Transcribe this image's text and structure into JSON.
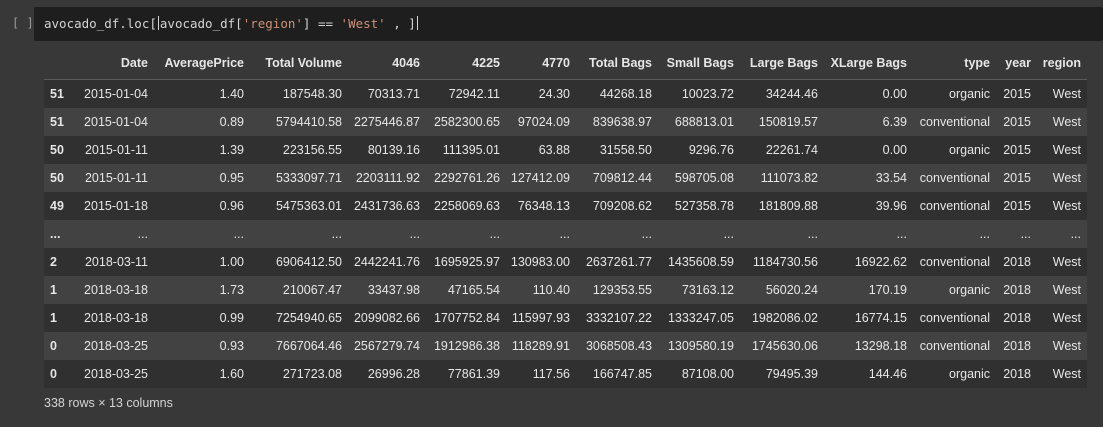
{
  "cell": {
    "run_indicator": "[ ]",
    "code": {
      "part1": "avocado_df.loc[",
      "part2": "avocado_df[",
      "string1": "'region'",
      "part3": "] == ",
      "string2": "'West'",
      "part4": " , ",
      "part5": "]"
    }
  },
  "table": {
    "columns": [
      "",
      "Date",
      "AveragePrice",
      "Total Volume",
      "4046",
      "4225",
      "4770",
      "Total Bags",
      "Small Bags",
      "Large Bags",
      "XLarge Bags",
      "type",
      "year",
      "region"
    ],
    "rows": [
      [
        "51",
        "2015-01-04",
        "1.40",
        "187548.30",
        "70313.71",
        "72942.11",
        "24.30",
        "44268.18",
        "10023.72",
        "34244.46",
        "0.00",
        "organic",
        "2015",
        "West"
      ],
      [
        "51",
        "2015-01-04",
        "0.89",
        "5794410.58",
        "2275446.87",
        "2582300.65",
        "97024.09",
        "839638.97",
        "688813.01",
        "150819.57",
        "6.39",
        "conventional",
        "2015",
        "West"
      ],
      [
        "50",
        "2015-01-11",
        "1.39",
        "223156.55",
        "80139.16",
        "111395.01",
        "63.88",
        "31558.50",
        "9296.76",
        "22261.74",
        "0.00",
        "organic",
        "2015",
        "West"
      ],
      [
        "50",
        "2015-01-11",
        "0.95",
        "5333097.71",
        "2203111.92",
        "2292761.26",
        "127412.09",
        "709812.44",
        "598705.08",
        "111073.82",
        "33.54",
        "conventional",
        "2015",
        "West"
      ],
      [
        "49",
        "2015-01-18",
        "0.96",
        "5475363.01",
        "2431736.63",
        "2258069.63",
        "76348.13",
        "709208.62",
        "527358.78",
        "181809.88",
        "39.96",
        "conventional",
        "2015",
        "West"
      ],
      [
        "...",
        "...",
        "...",
        "...",
        "...",
        "...",
        "...",
        "...",
        "...",
        "...",
        "...",
        "...",
        "...",
        "..."
      ],
      [
        "2",
        "2018-03-11",
        "1.00",
        "6906412.50",
        "2442241.76",
        "1695925.97",
        "130983.00",
        "2637261.77",
        "1435608.59",
        "1184730.56",
        "16922.62",
        "conventional",
        "2018",
        "West"
      ],
      [
        "1",
        "2018-03-18",
        "1.73",
        "210067.47",
        "33437.98",
        "47165.54",
        "110.40",
        "129353.55",
        "73163.12",
        "56020.24",
        "170.19",
        "organic",
        "2018",
        "West"
      ],
      [
        "1",
        "2018-03-18",
        "0.99",
        "7254940.65",
        "2099082.66",
        "1707752.84",
        "115997.93",
        "3332107.22",
        "1333247.05",
        "1982086.02",
        "16774.15",
        "conventional",
        "2018",
        "West"
      ],
      [
        "0",
        "2018-03-25",
        "0.93",
        "7667064.46",
        "2567279.74",
        "1912986.38",
        "118289.91",
        "3068508.43",
        "1309580.19",
        "1745630.06",
        "13298.18",
        "conventional",
        "2018",
        "West"
      ],
      [
        "0",
        "2018-03-25",
        "1.60",
        "271723.08",
        "26996.28",
        "77861.39",
        "117.56",
        "166747.85",
        "87108.00",
        "79495.39",
        "144.46",
        "organic",
        "2018",
        "West"
      ]
    ],
    "shape_note": "338 rows × 13 columns"
  },
  "colors": {
    "background": "#383838",
    "editor_background": "#1e1e1e",
    "string_literal": "#ce9178",
    "row_dark": "#303030",
    "row_light": "#424242"
  }
}
